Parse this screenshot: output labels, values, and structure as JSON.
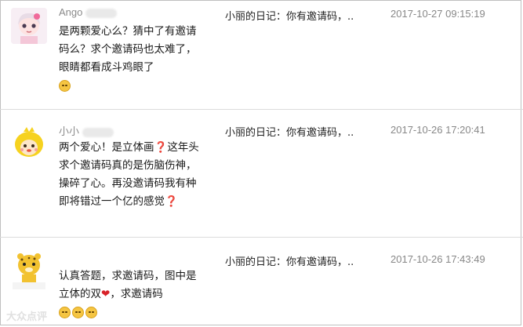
{
  "comments": [
    {
      "username": "Ango",
      "content": "是两颗爱心么？猜中了有邀请码么？求个邀请码也太难了，眼睛都看成斗鸡眼了",
      "emoji_count": 1,
      "source": "小丽的日记：你有邀请码，..",
      "time": "2017-10-27 09:15:19"
    },
    {
      "username": "小小",
      "content_parts": [
        "两个爱心！是立体画",
        "❓",
        "这年头求个邀请码真的是伤脑伤神，操碎了心。再没邀请码我有种即将错过一个亿的感觉",
        "❓"
      ],
      "source": "小丽的日记：你有邀请码，..",
      "time": "2017-10-26 17:20:41"
    },
    {
      "username": "",
      "content_parts": [
        "认真答题，求邀请码，图中是立体的双",
        "❤",
        "，求邀请码"
      ],
      "emoji_count": 3,
      "source": "小丽的日记：你有邀请码，..",
      "time": "2017-10-26 17:43:49"
    }
  ],
  "watermark": "大众点评"
}
